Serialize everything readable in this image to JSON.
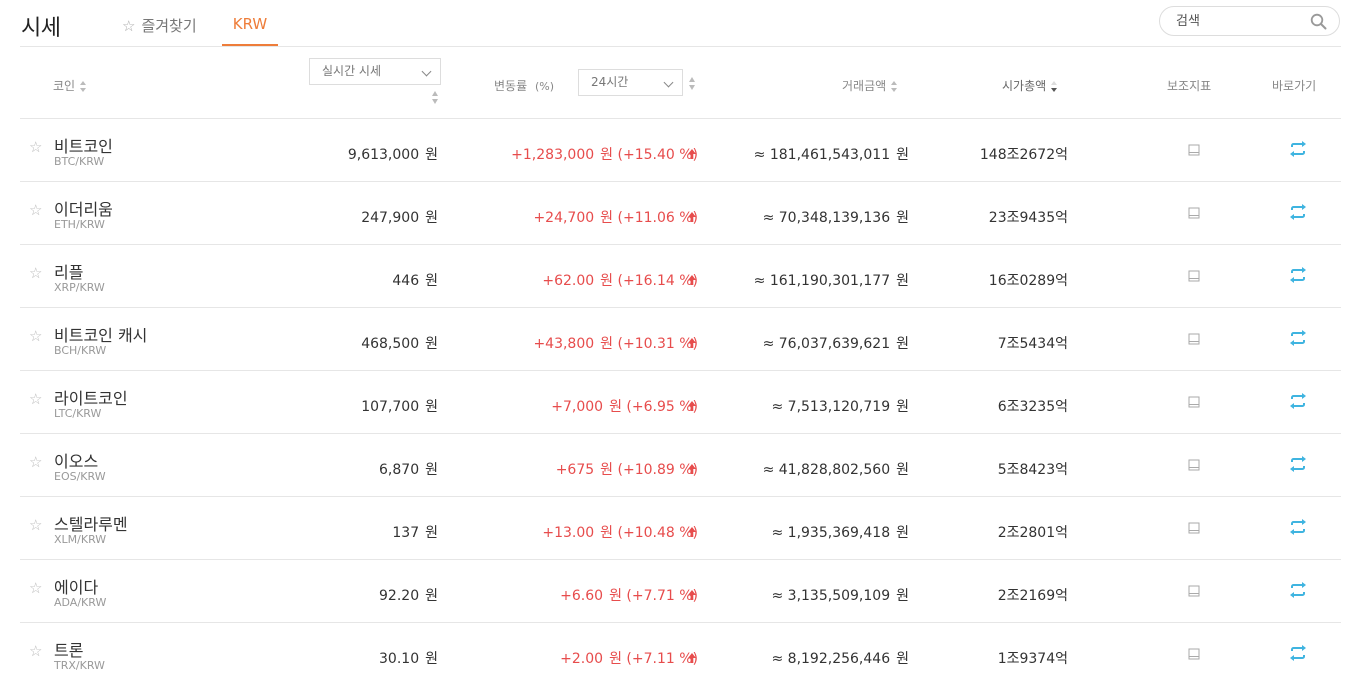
{
  "header": {
    "title": "시세",
    "tabs": [
      {
        "label": "즐겨찾기",
        "active": false
      },
      {
        "label": "KRW",
        "active": true
      }
    ],
    "search_placeholder": "검색"
  },
  "columns": {
    "coin": "코인",
    "price_mode": "실시간 시세",
    "change": "변동률",
    "change_unit": "(%)",
    "period": "24시간",
    "volume": "거래금액",
    "market_cap": "시가총액",
    "indicator": "보조지표",
    "shortcut": "바로가기"
  },
  "currency_unit": "원",
  "approx": "≈",
  "colors": {
    "accent": "#ee7d3a",
    "up": "#e74c4c",
    "shortcut": "#3fb4e0"
  },
  "rows": [
    {
      "name": "비트코인",
      "pair": "BTC/KRW",
      "price": "9,613,000",
      "change": "+1,283,000",
      "change_pct": "(+15.40 %)",
      "volume": "181,461,543,011",
      "market_cap": "148조2672억"
    },
    {
      "name": "이더리움",
      "pair": "ETH/KRW",
      "price": "247,900",
      "change": "+24,700",
      "change_pct": "(+11.06 %)",
      "volume": "70,348,139,136",
      "market_cap": "23조9435억"
    },
    {
      "name": "리플",
      "pair": "XRP/KRW",
      "price": "446",
      "change": "+62.00",
      "change_pct": "(+16.14 %)",
      "volume": "161,190,301,177",
      "market_cap": "16조0289억"
    },
    {
      "name": "비트코인 캐시",
      "pair": "BCH/KRW",
      "price": "468,500",
      "change": "+43,800",
      "change_pct": "(+10.31 %)",
      "volume": "76,037,639,621",
      "market_cap": "7조5434억"
    },
    {
      "name": "라이트코인",
      "pair": "LTC/KRW",
      "price": "107,700",
      "change": "+7,000",
      "change_pct": "(+6.95 %)",
      "volume": "7,513,120,719",
      "market_cap": "6조3235억"
    },
    {
      "name": "이오스",
      "pair": "EOS/KRW",
      "price": "6,870",
      "change": "+675",
      "change_pct": "(+10.89 %)",
      "volume": "41,828,802,560",
      "market_cap": "5조8423억"
    },
    {
      "name": "스텔라루멘",
      "pair": "XLM/KRW",
      "price": "137",
      "change": "+13.00",
      "change_pct": "(+10.48 %)",
      "volume": "1,935,369,418",
      "market_cap": "2조2801억"
    },
    {
      "name": "에이다",
      "pair": "ADA/KRW",
      "price": "92.20",
      "change": "+6.60",
      "change_pct": "(+7.71 %)",
      "volume": "3,135,509,109",
      "market_cap": "2조2169억"
    },
    {
      "name": "트론",
      "pair": "TRX/KRW",
      "price": "30.10",
      "change": "+2.00",
      "change_pct": "(+7.11 %)",
      "volume": "8,192,256,446",
      "market_cap": "1조9374억"
    }
  ]
}
